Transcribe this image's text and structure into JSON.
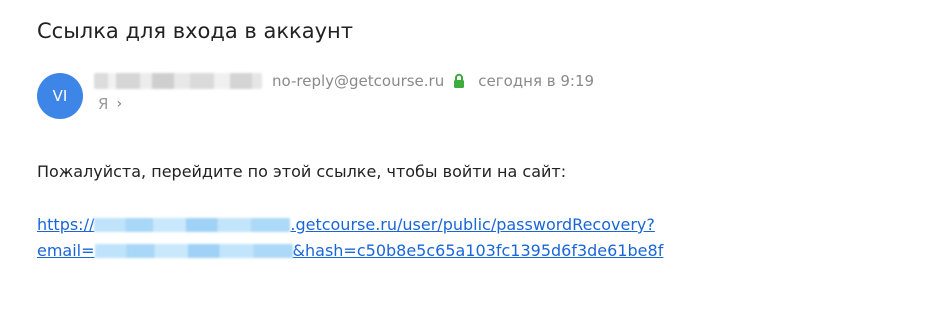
{
  "email": {
    "subject": "Ссылка для входа в аккаунт",
    "avatar_initials": "VI",
    "sender_email": "no-reply@getcourse.ru",
    "timestamp": "сегодня в 9:19",
    "recipient": "Я",
    "body_text": "Пожалуйста, перейдите по этой ссылке, чтобы войти на сайт:",
    "link": {
      "line1_prefix": "https://",
      "line1_suffix": ".getcourse.ru/user/public/passwordRecovery?",
      "line2_prefix": "email=",
      "line2_suffix": "&hash=c50b8e5c65a103fc1395d6f3de61be8f"
    }
  },
  "icons": {
    "lock": "lock-icon",
    "chevron": "chevron-right-icon"
  },
  "colors": {
    "avatar_bg": "#3d85e6",
    "lock_green": "#3dab3d",
    "link": "#1a66d6",
    "muted_text": "#8a8a8a"
  }
}
